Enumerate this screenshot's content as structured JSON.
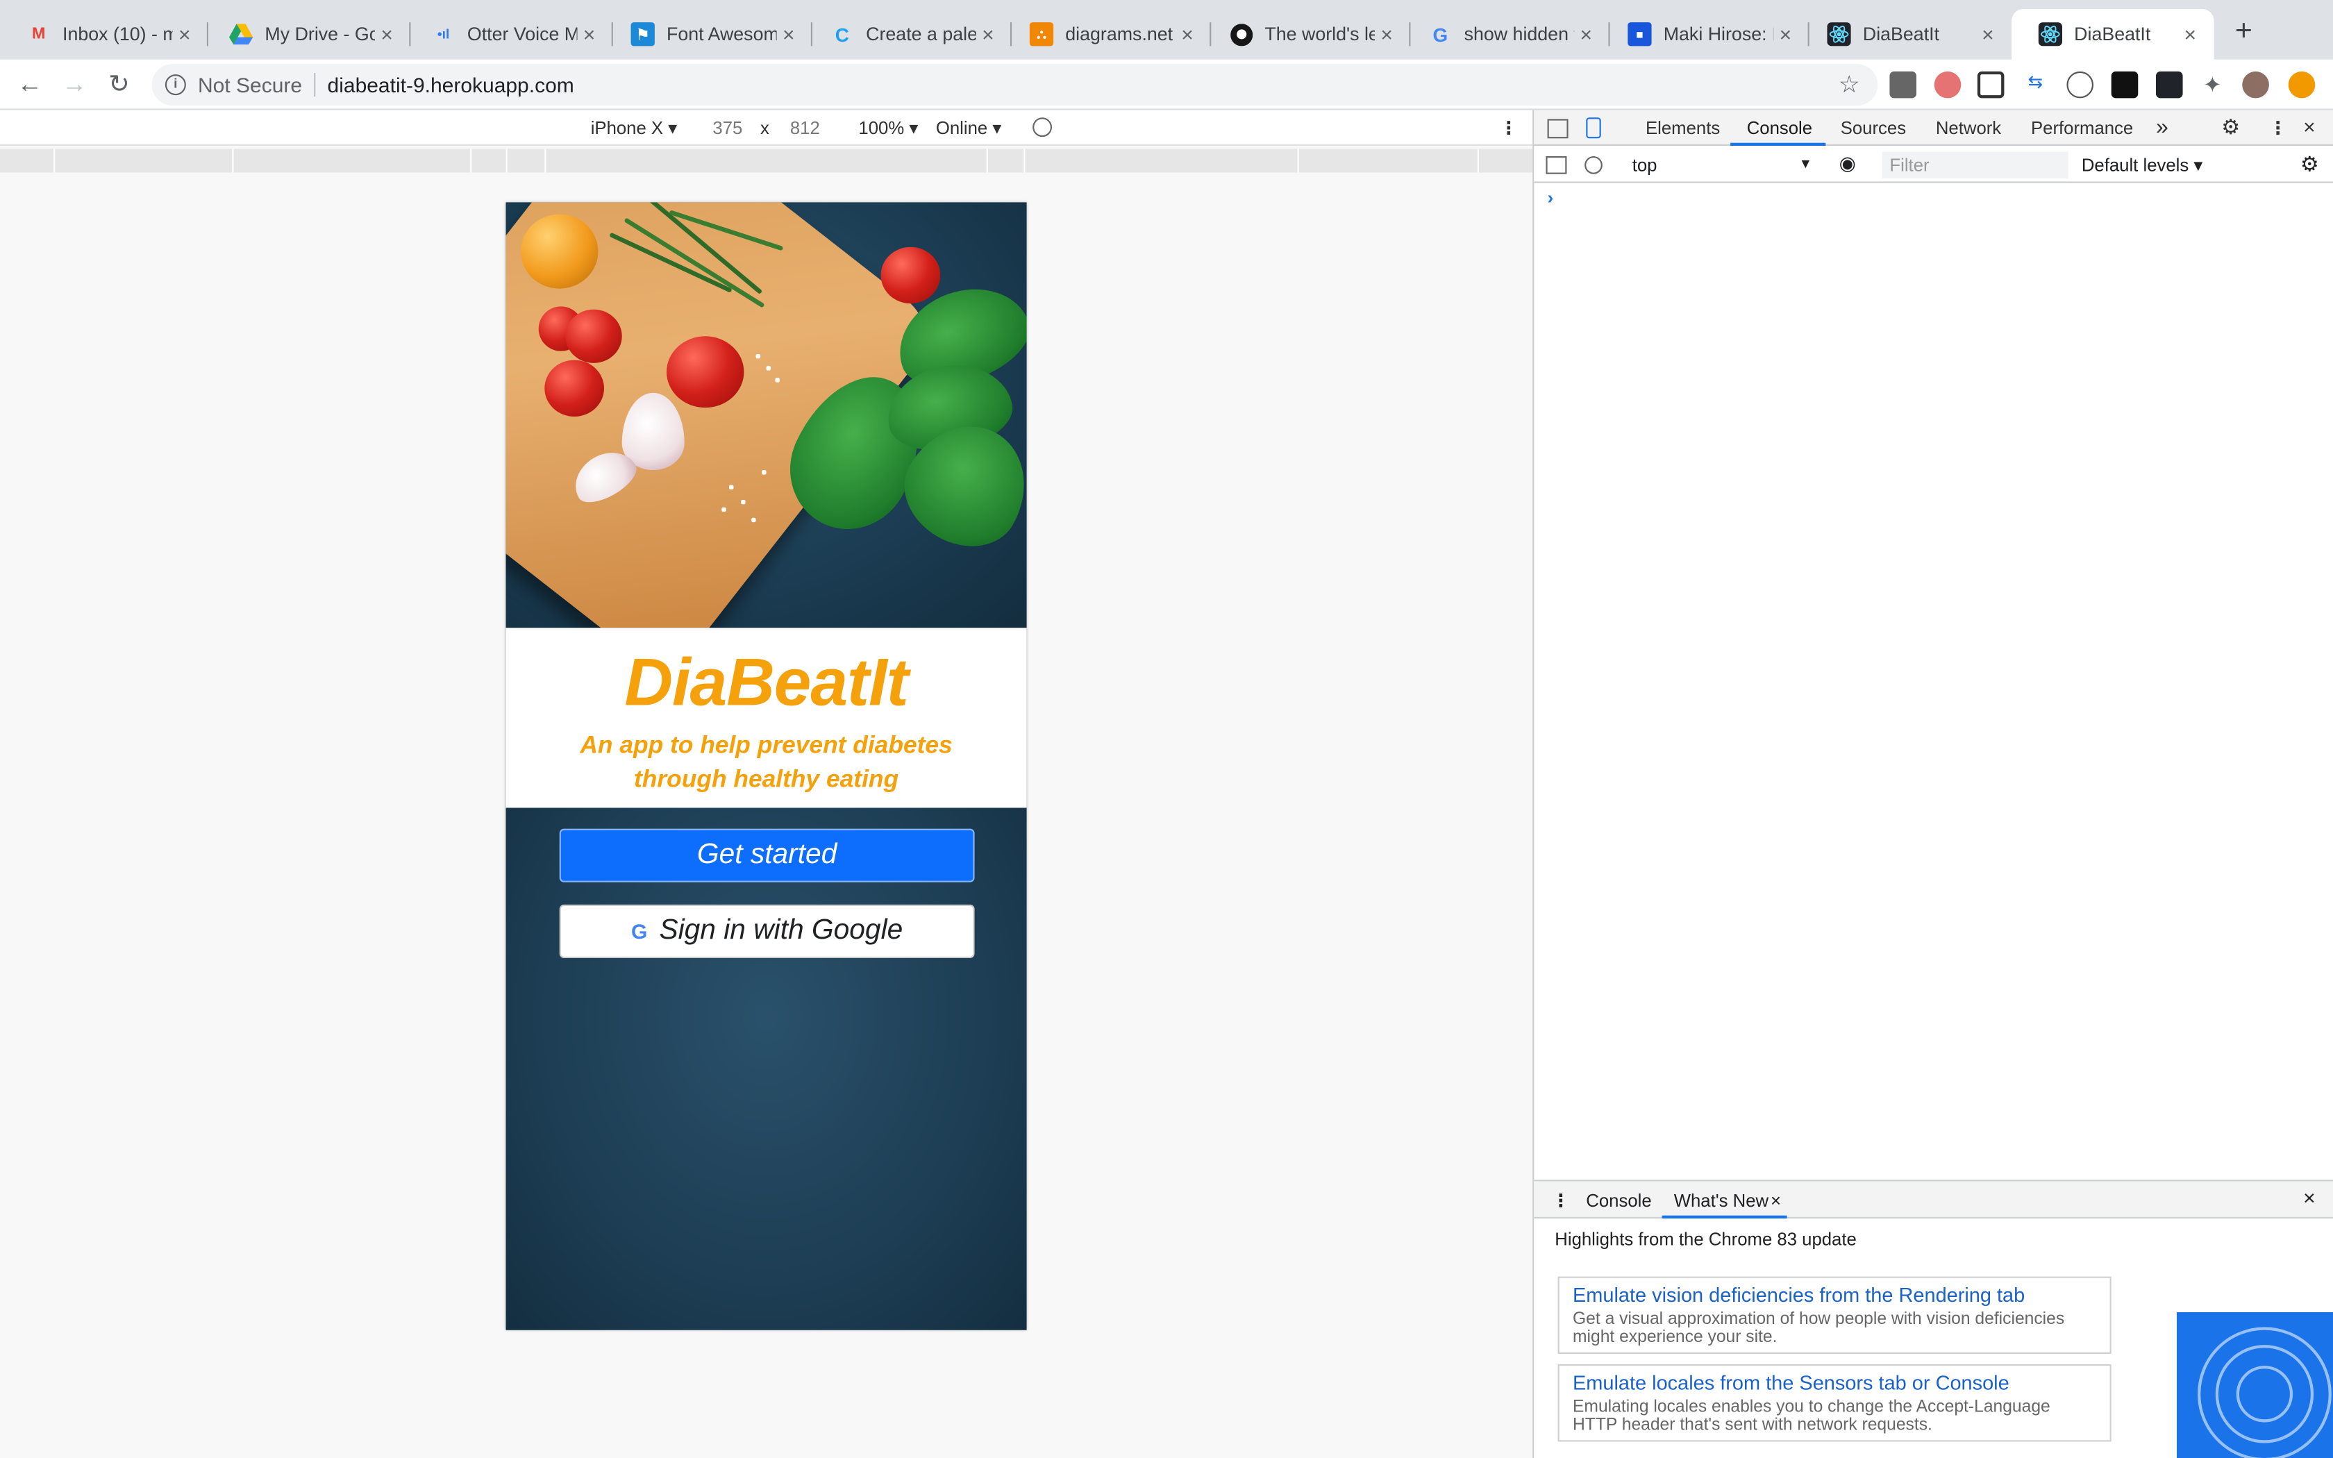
{
  "browser": {
    "tabs": [
      {
        "title": "Inbox (10) - m",
        "icon": "gmail-icon",
        "color": "#ea4335"
      },
      {
        "title": "My Drive - Go",
        "icon": "google-drive-icon",
        "color": "#1fa463"
      },
      {
        "title": "Otter Voice M",
        "icon": "otter-icon",
        "color": "#2e7df6"
      },
      {
        "title": "Font Awesom",
        "icon": "font-awesome-icon",
        "color": "#1c88d8"
      },
      {
        "title": "Create a palet",
        "icon": "coolors-icon",
        "color": "#1e9ff2"
      },
      {
        "title": "diagrams.net",
        "icon": "diagrams-icon",
        "color": "#f08705"
      },
      {
        "title": "The world's le",
        "icon": "github-icon",
        "color": "#181717"
      },
      {
        "title": "show hidden f",
        "icon": "google-icon",
        "color": "#4285f4"
      },
      {
        "title": "Maki Hirose: L",
        "icon": "page-icon",
        "color": "#1a56db"
      },
      {
        "title": "DiaBeatIt",
        "icon": "react-icon",
        "color": "#61dafb"
      },
      {
        "title": "DiaBeatIt",
        "icon": "react-icon",
        "color": "#61dafb",
        "active": true
      }
    ],
    "new_tab": "+",
    "security_label": "Not Secure",
    "url": "diabeatit-9.herokuapp.com"
  },
  "device_toolbar": {
    "device": "iPhone X ▾",
    "width": "375",
    "times": "x",
    "height": "812",
    "zoom": "100% ▾",
    "network": "Online ▾"
  },
  "app": {
    "name": "DiaBeatIt",
    "tagline_line1": "An app to help prevent diabetes",
    "tagline_line2": "through healthy eating",
    "get_started": "Get started",
    "google_glyph": "G",
    "google_signin": "Sign in with Google"
  },
  "devtools": {
    "tabs": [
      "Elements",
      "Console",
      "Sources",
      "Network",
      "Performance"
    ],
    "more": "»",
    "context": "top",
    "filter_placeholder": "Filter",
    "levels": "Default levels ▾",
    "drawer_tabs": [
      "Console",
      "What's New"
    ],
    "highlights": "Highlights from the Chrome 83 update",
    "cards": [
      {
        "title": "Emulate vision deficiencies from the Rendering tab",
        "desc": "Get a visual approximation of how people with vision deficiencies might experience your site."
      },
      {
        "title": "Emulate locales from the Sensors tab or Console",
        "desc": "Emulating locales enables you to change the Accept-Language HTTP header that's sent with network requests."
      }
    ]
  },
  "colors": {
    "accent": "#f5a10c",
    "primary": "#0d6efd",
    "devtools_blue": "#1a73e8"
  }
}
